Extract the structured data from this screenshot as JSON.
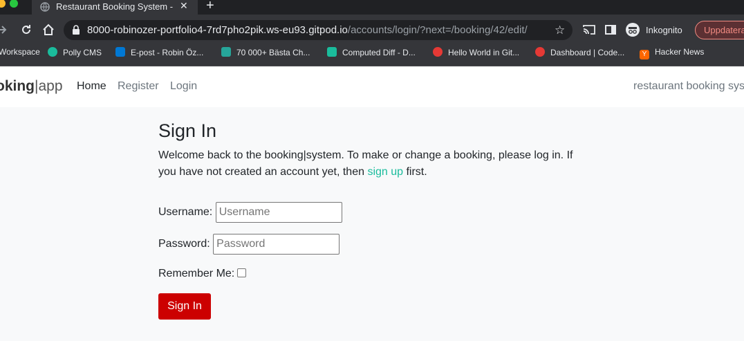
{
  "browser": {
    "tab_title": "Restaurant Booking System - L",
    "url_host": "8000-robinozer-portfolio4-7rd7pho2pik.ws-eu93.gitpod.io",
    "url_path": "/accounts/login/?next=/booking/42/edit/",
    "profile_label": "Inkognito",
    "update_label": "Uppdatera"
  },
  "bookmarks": [
    {
      "label": "Workspace",
      "color": "#5f6368"
    },
    {
      "label": "Polly CMS",
      "color": "#1abc9c"
    },
    {
      "label": "E-post - Robin Öz...",
      "color": "#0078d4"
    },
    {
      "label": "70 000+ Bästa Ch...",
      "color": "#26a69a"
    },
    {
      "label": "Computed Diff - D...",
      "color": "#1abc9c"
    },
    {
      "label": "Hello World in Git...",
      "color": "#e53935"
    },
    {
      "label": "Dashboard | Code...",
      "color": "#e53935"
    },
    {
      "label": "Hacker News",
      "color": "#ff6600"
    }
  ],
  "navbar": {
    "brand_bold": "oking",
    "brand_sep": "|",
    "brand_light": "app",
    "links": [
      "Home",
      "Register",
      "Login"
    ],
    "tagline": "restaurant booking sys"
  },
  "page": {
    "title": "Sign In",
    "intro_before": "Welcome back to the booking|system. To make or change a booking, please log in. If you have not created an account yet, then ",
    "intro_link": "sign up",
    "intro_after": " first.",
    "username_label": "Username:",
    "username_placeholder": "Username",
    "password_label": "Password:",
    "password_placeholder": "Password",
    "remember_label": "Remember Me:",
    "submit_label": "Sign In"
  },
  "colors": {
    "accent": "#1abc9c",
    "button": "#cc0000"
  }
}
